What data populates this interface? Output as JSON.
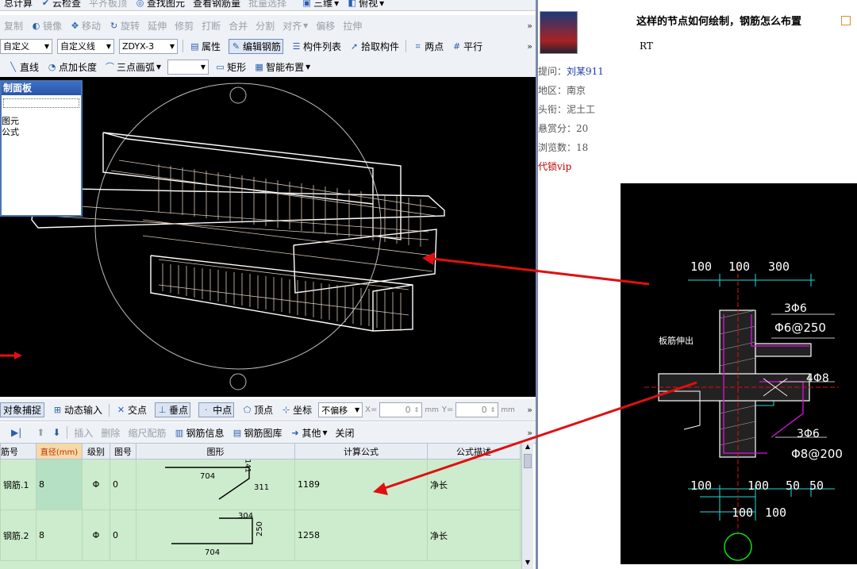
{
  "toolbar1": {
    "items": [
      "总计算",
      "云检查",
      "平齐板顶",
      "查找图元",
      "查看钢筋量",
      "批量选择",
      "三维",
      "俯视"
    ]
  },
  "toolbar2": {
    "items": [
      "复制",
      "镜像",
      "移动",
      "旋转",
      "延伸",
      "修剪",
      "打断",
      "合并",
      "分割",
      "对齐",
      "偏移",
      "拉伸"
    ]
  },
  "toolbar3": {
    "combo1": "自定义",
    "combo2": "自定义线",
    "combo3": "ZDYX-3",
    "items": [
      "属性",
      "编辑钢筋",
      "构件列表",
      "拾取构件",
      "两点",
      "平行"
    ]
  },
  "toolbar4": {
    "items": [
      "直线",
      "点加长度",
      "三点画弧",
      "矩形",
      "智能布置"
    ]
  },
  "panel": {
    "title": "制面板",
    "lines": [
      "图元",
      "公式"
    ]
  },
  "snapbar": {
    "items": [
      "对象捕捉",
      "动态输入",
      "交点",
      "垂点",
      "中点",
      "顶点",
      "坐标"
    ],
    "offset_mode": "不偏移",
    "x_label": "X=",
    "x_value": "0",
    "y_label": "Y=",
    "y_value": "0",
    "unit": "mm"
  },
  "rebar_toolbar": {
    "items": [
      "插入",
      "删除",
      "缩尺配筋",
      "钢筋信息",
      "钢筋图库",
      "其他",
      "关闭"
    ]
  },
  "grid": {
    "headers": [
      "筋号",
      "直径(mm)",
      "级别",
      "图号",
      "图形",
      "计算公式",
      "公式描述"
    ],
    "rows": [
      {
        "name": "钢筋.1",
        "diameter": "8",
        "grade": "Φ",
        "figure_no": "0",
        "shape_a": "704",
        "shape_b": "311",
        "shape_c": "141",
        "formula": "1189",
        "desc": "净长"
      },
      {
        "name": "钢筋.2",
        "diameter": "8",
        "grade": "Φ",
        "figure_no": "0",
        "shape_a": "304",
        "shape_b": "250",
        "shape_c": "704",
        "formula": "1258",
        "desc": "净长"
      }
    ]
  },
  "post": {
    "title": "这样的节点如何绘制，钢筋怎么布置",
    "body": "RT",
    "asker_label": "提问：",
    "asker": "刘某911",
    "region": "地区：南京",
    "title_rank": "头衔：泥土工",
    "reward": "悬赏分：20",
    "views": "浏览数：18",
    "vip": "代锁vip"
  },
  "cad": {
    "dims_top": [
      "100",
      "100",
      "300"
    ],
    "note1": "3Φ6",
    "note2": "Φ6@250",
    "note3": "4Φ8",
    "note4": "3Φ6",
    "note5": "Φ8@200",
    "label_left": "板筋伸出",
    "dims_bottom": [
      "100",
      "100",
      "50",
      "50"
    ],
    "dims_bottom2": [
      "100",
      "100"
    ]
  }
}
